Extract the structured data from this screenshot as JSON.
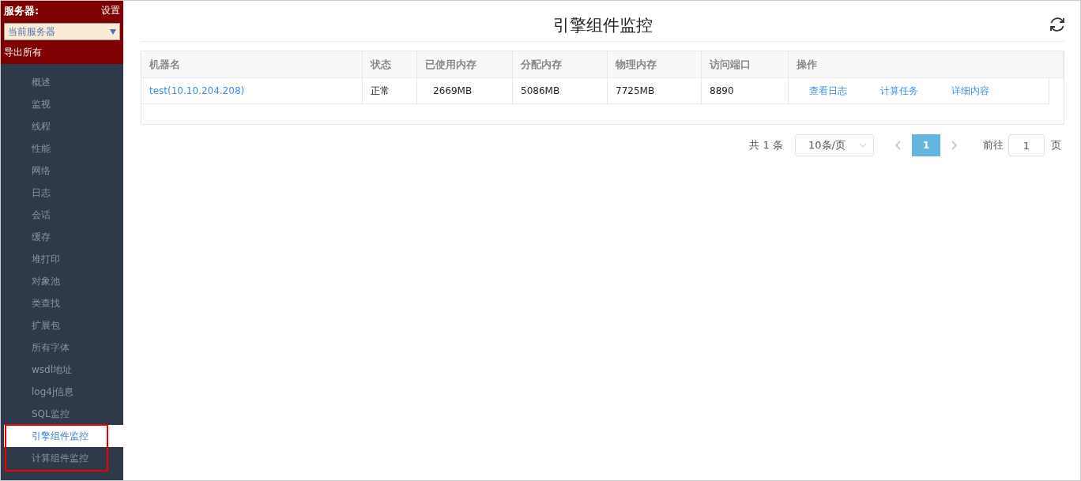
{
  "sidebar": {
    "server_label": "服务器:",
    "settings_link": "设置",
    "server_select": {
      "value": "当前服务器"
    },
    "export_link": "导出所有",
    "items": [
      {
        "label": "概述",
        "selected": false
      },
      {
        "label": "监视",
        "selected": false
      },
      {
        "label": "线程",
        "selected": false
      },
      {
        "label": "性能",
        "selected": false
      },
      {
        "label": "网络",
        "selected": false
      },
      {
        "label": "日志",
        "selected": false
      },
      {
        "label": "会话",
        "selected": false
      },
      {
        "label": "缓存",
        "selected": false
      },
      {
        "label": "堆打印",
        "selected": false
      },
      {
        "label": "对象池",
        "selected": false
      },
      {
        "label": "类查找",
        "selected": false
      },
      {
        "label": "扩展包",
        "selected": false
      },
      {
        "label": "所有字体",
        "selected": false
      },
      {
        "label": "wsdl地址",
        "selected": false
      },
      {
        "label": "log4j信息",
        "selected": false
      },
      {
        "label": "SQL监控",
        "selected": false
      },
      {
        "label": "引擎组件监控",
        "selected": true
      },
      {
        "label": "计算组件监控",
        "selected": false
      }
    ]
  },
  "page": {
    "title": "引擎组件监控"
  },
  "table": {
    "columns": [
      "机器名",
      "状态",
      "已使用内存",
      "分配内存",
      "物理内存",
      "访问端口",
      "操作"
    ],
    "rows": [
      {
        "machine": "test(10.10.204.208)",
        "status": "正常",
        "used_memory": "2669MB",
        "allocated_memory": "5086MB",
        "physical_memory": "7725MB",
        "port": "8890",
        "actions": [
          "查看日志",
          "计算任务",
          "详细内容"
        ]
      }
    ]
  },
  "pagination": {
    "total": "共 1 条",
    "page_size": "10条/页",
    "pages": [
      {
        "label": "1",
        "selected": true
      }
    ],
    "goto_label": "前往",
    "goto_value": "1",
    "page_suffix": "页"
  }
}
